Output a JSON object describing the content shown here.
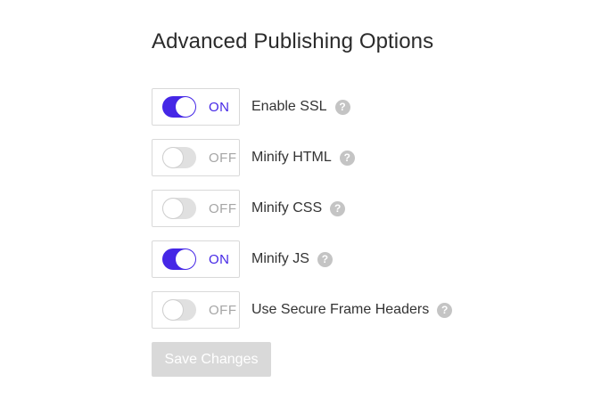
{
  "page": {
    "title": "Advanced Publishing Options"
  },
  "options": [
    {
      "label": "Enable SSL",
      "enabled": true,
      "state_text": "ON",
      "help_icon": "question-mark"
    },
    {
      "label": "Minify HTML",
      "enabled": false,
      "state_text": "OFF",
      "help_icon": "question-mark"
    },
    {
      "label": "Minify CSS",
      "enabled": false,
      "state_text": "OFF",
      "help_icon": "question-mark"
    },
    {
      "label": "Minify JS",
      "enabled": true,
      "state_text": "ON",
      "help_icon": "question-mark"
    },
    {
      "label": "Use Secure Frame Headers",
      "enabled": false,
      "state_text": "OFF",
      "help_icon": "question-mark"
    }
  ],
  "help_glyph": "?",
  "save_button": {
    "label": "Save Changes",
    "disabled": true
  },
  "colors": {
    "accent": "#4527e6",
    "off_track": "#e0e0e0",
    "off_text": "#a6a6a6",
    "help_icon_bg": "#c4c4c4",
    "disabled_button_bg": "#d9d9d9"
  }
}
